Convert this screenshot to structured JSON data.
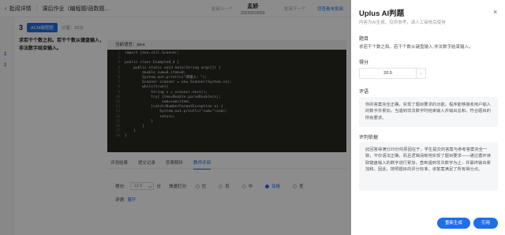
{
  "header": {
    "back_label": "批阅详情",
    "breadcrumb": "课后作业（编程题/函数题...",
    "student_name": "孟娇",
    "student_id": "20220010003",
    "prev_label": "批阅上一个",
    "next_label": "批阅下一个",
    "link_label": "切查看未批阅"
  },
  "strip": {
    "numbers": [
      "1",
      "2"
    ]
  },
  "question": {
    "number": "3",
    "type_badge": "ACM编程题",
    "score": "分值：20分",
    "text": "求若干个数之和。若干个数从键盘输入，非法数字结束输入。"
  },
  "editor": {
    "language": "当前语言：java",
    "lines": [
      "import java.util.Scanner;",
      "",
      "public class Example8_4 {",
      "    public static void main(String args[]) {",
      "        double sum=0,item=0;",
      "        System.out.println(\"请输入：\");",
      "        Scanner scanner = new Scanner(System.in);",
      "        while(true){",
      "            String s = scanner.next();",
      "            try{ item=Double.parseDouble(s);",
      "                 sum=sum+item;",
      "            }catch(NumberFormatException e) {",
      "                System.out.println(\"sum=\"+sum);",
      "                return;",
      "            }",
      "        }",
      "    }",
      "}"
    ]
  },
  "tabs": [
    "评测结果",
    "提交记录",
    "答案解析",
    "教师评阅"
  ],
  "grading": {
    "score_label": "得分:",
    "score_value": "12.0",
    "unit": "分",
    "quick_label": "快速打分:",
    "options": [
      "优",
      "良",
      "中",
      "及格",
      "差"
    ],
    "selected": "及格",
    "comment_label": "评语:",
    "expand_label": "展开"
  },
  "ai_panel": {
    "title": "Uplus AI判题",
    "subtitle": "内容为AI生成，仅供参考，请人工审核后使用",
    "close": "×",
    "question_label": "题目",
    "question_text": "求若干个数之和。若干个数从键盘输入,非法数字结束输入。",
    "score_label": "得分",
    "score_value": "20.0",
    "stepper": "⌄",
    "review_label": "评语",
    "review_text": "你的答案完全正确，实现了题目要求的功能。程序能够接收用户输入的数字并累加，当遇到非法数字时结束输入并输出总和，符合题目的所有要求。",
    "basis_label": "评判依据",
    "basis_text": "此回答得满分20分的原因在于，学生提交的答案与参考答案完全一致，不仅语法正确，而且逻辑清晰地实现了题目要求——通过循环读取键盘输入的数字进行累加，直到遇到非法数字为止，并最终输出累加和。因此，按照题目的评分标准，该答案满足了所有得分点。",
    "regen_label": "重新生成",
    "cite_label": "引用"
  },
  "colors": {
    "accent": "#1e6fe8",
    "code_bg": "#272822"
  }
}
